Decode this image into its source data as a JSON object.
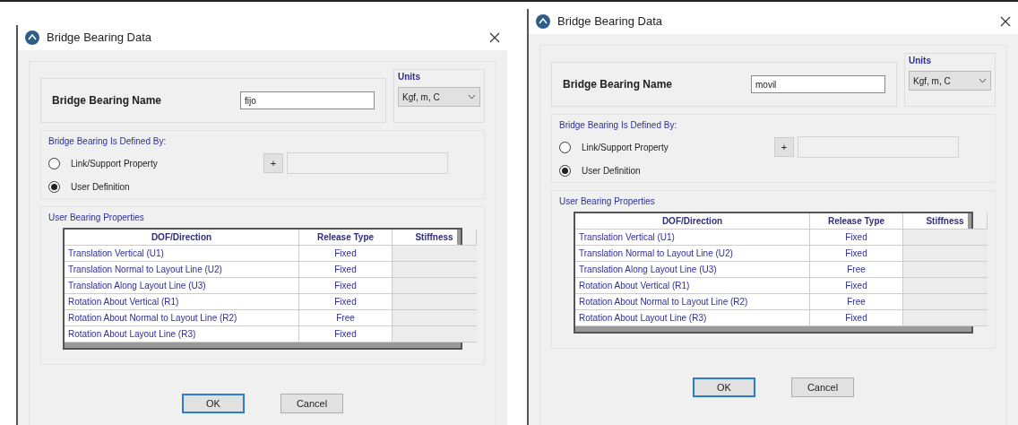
{
  "dialogs": [
    {
      "title": "Bridge Bearing Data",
      "name_label": "Bridge Bearing Name",
      "name_value": "fijo",
      "units_label": "Units",
      "units_value": "Kgf, m, C",
      "defined_by_label": "Bridge Bearing Is Defined By:",
      "options": [
        {
          "label": "Link/Support Property",
          "selected": false
        },
        {
          "label": "User Definition",
          "selected": true
        }
      ],
      "plus_button": "+",
      "properties_label": "User Bearing Properties",
      "columns": [
        "DOF/Direction",
        "Release Type",
        "Stiffness"
      ],
      "rows": [
        {
          "dof": "Translation Vertical (U1)",
          "release": "Fixed"
        },
        {
          "dof": "Translation Normal to Layout Line (U2)",
          "release": "Fixed"
        },
        {
          "dof": "Translation Along Layout Line (U3)",
          "release": "Fixed"
        },
        {
          "dof": "Rotation About Vertical (R1)",
          "release": "Fixed"
        },
        {
          "dof": "Rotation About Normal to Layout Line (R2)",
          "release": "Free"
        },
        {
          "dof": "Rotation About Layout Line (R3)",
          "release": "Fixed"
        }
      ],
      "buttons": [
        {
          "label": "OK",
          "focused": true
        },
        {
          "label": "Cancel",
          "focused": false
        }
      ]
    },
    {
      "title": "Bridge Bearing Data",
      "name_label": "Bridge Bearing Name",
      "name_value": "movil",
      "units_label": "Units",
      "units_value": "Kgf, m, C",
      "defined_by_label": "Bridge Bearing Is Defined By:",
      "options": [
        {
          "label": "Link/Support Property",
          "selected": false
        },
        {
          "label": "User Definition",
          "selected": true
        }
      ],
      "plus_button": "+",
      "properties_label": "User Bearing Properties",
      "columns": [
        "DOF/Direction",
        "Release Type",
        "Stiffness"
      ],
      "rows": [
        {
          "dof": "Translation Vertical (U1)",
          "release": "Fixed"
        },
        {
          "dof": "Translation Normal to Layout Line (U2)",
          "release": "Fixed"
        },
        {
          "dof": "Translation Along Layout Line (U3)",
          "release": "Free"
        },
        {
          "dof": "Rotation About Vertical (R1)",
          "release": "Fixed"
        },
        {
          "dof": "Rotation About Normal to Layout Line (R2)",
          "release": "Free"
        },
        {
          "dof": "Rotation About Layout Line (R3)",
          "release": "Fixed"
        }
      ],
      "buttons": [
        {
          "label": "OK",
          "focused": true
        },
        {
          "label": "Cancel",
          "focused": false
        }
      ]
    }
  ]
}
